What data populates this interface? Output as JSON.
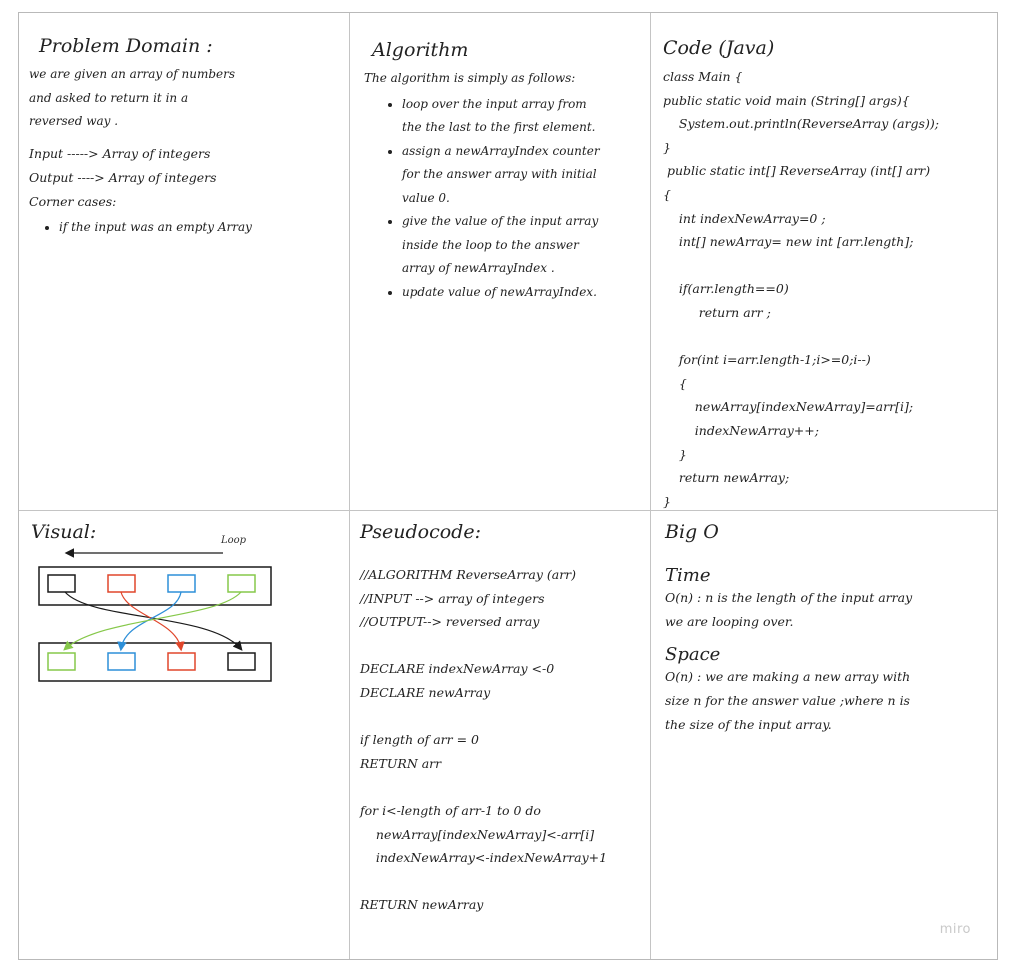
{
  "problem": {
    "title": "Problem Domain :",
    "lines": [
      "we are given an array of numbers",
      "and asked to return it in a",
      "reversed way ."
    ],
    "io": [
      "Input -----> Array of integers",
      "Output ----> Array of integers",
      "Corner cases:"
    ],
    "corner_cases": [
      "if the input was an empty Array"
    ]
  },
  "algorithm": {
    "title": "Algorithm",
    "intro": "The algorithm is simply as follows:",
    "steps": [
      "loop over the input array from the the last to the first element.",
      "assign a newArrayIndex counter for the answer array with initial value 0.",
      "give the value of the input array inside the loop to the answer array of newArrayIndex .",
      "update value of newArrayIndex."
    ]
  },
  "code": {
    "title": "Code (Java)",
    "lines": [
      "class Main {",
      "public static void main (String[] args){",
      "    System.out.println(ReverseArray (args));",
      "}",
      " public static int[] ReverseArray (int[] arr)",
      "{",
      "    int indexNewArray=0 ;",
      "    int[] newArray= new int [arr.length];",
      "",
      "    if(arr.length==0)",
      "         return arr ;",
      "",
      "    for(int i=arr.length-1;i>=0;i--)",
      "    {",
      "        newArray[indexNewArray]=arr[i];",
      "        indexNewArray++;",
      "    }",
      "    return newArray;",
      "}"
    ]
  },
  "visual": {
    "title": "Visual:",
    "loop_label": "Loop",
    "colors": {
      "black": "#1a1a1a",
      "red": "#e0462b",
      "blue": "#2d8fd8",
      "green": "#86c84a"
    }
  },
  "pseudocode": {
    "title": "Pseudocode:",
    "lines": [
      "//ALGORITHM ReverseArray (arr)",
      "//INPUT --> array of integers",
      "//OUTPUT--> reversed array",
      "",
      "DECLARE indexNewArray <-0",
      "DECLARE newArray",
      "",
      "if length of arr = 0",
      "RETURN arr",
      "",
      "for i<-length of arr-1 to 0 do",
      "    newArray[indexNewArray]<-arr[i]",
      "    indexNewArray<-indexNewArray+1",
      "",
      "RETURN newArray"
    ]
  },
  "bigo": {
    "title": "Big O",
    "time_heading": "Time",
    "time_lines": [
      "O(n) : n is the length of the input array",
      "we are looping over."
    ],
    "space_heading": "Space",
    "space_lines": [
      "O(n) : we are making a new array with",
      "size n for the answer value ;where n is",
      "the size of the input array."
    ]
  },
  "watermark": "miro"
}
